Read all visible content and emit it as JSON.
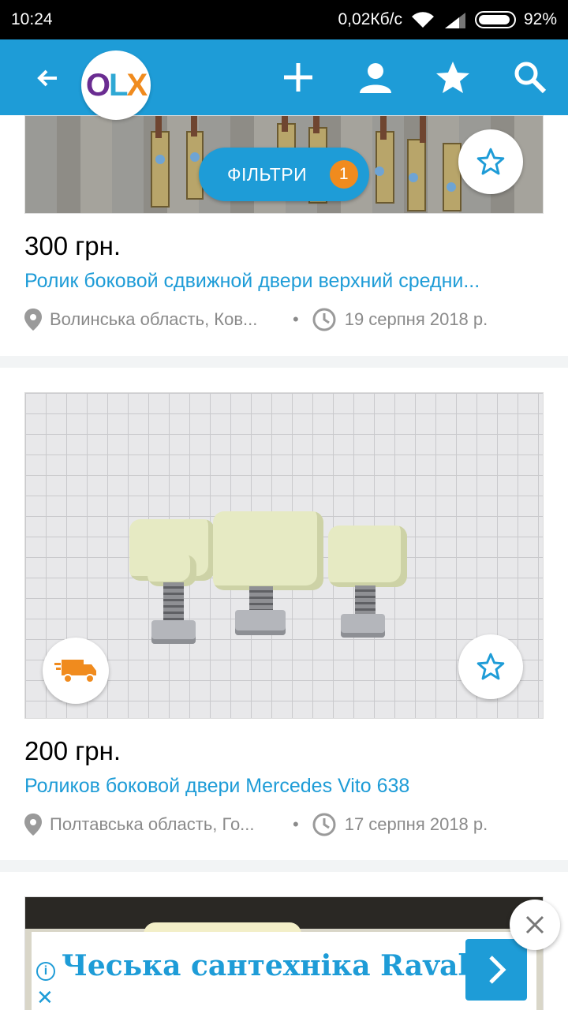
{
  "status_bar": {
    "time": "10:24",
    "network_speed": "0,02Кб/с",
    "battery": "92%",
    "battery_level": 0.92
  },
  "header": {
    "logo": "OLX",
    "icons": [
      "back-arrow-icon",
      "plus-icon",
      "user-icon",
      "star-icon",
      "search-icon"
    ]
  },
  "filters": {
    "label": "ФІЛЬТРИ",
    "count": "1"
  },
  "listings": [
    {
      "price": "300 грн.",
      "title": "Ролик боковой сдвижной двери верхний средни...",
      "location": "Волинська область, Ков...",
      "separator": "•",
      "date": "19 серпня 2018 р."
    },
    {
      "price": "200 грн.",
      "title": "Роликов боковой двери  Mercedes Vito 638",
      "location": "Полтавська область, Го...",
      "separator": "•",
      "date": "17 серпня 2018 р."
    }
  ],
  "ad": {
    "text": "Чеська сантехніка Ravak",
    "info": "i",
    "close_mark": "✕"
  },
  "colors": {
    "brand_blue": "#1e9cd7",
    "badge_orange": "#f08b1e",
    "text_grey": "#8a8a8a"
  }
}
